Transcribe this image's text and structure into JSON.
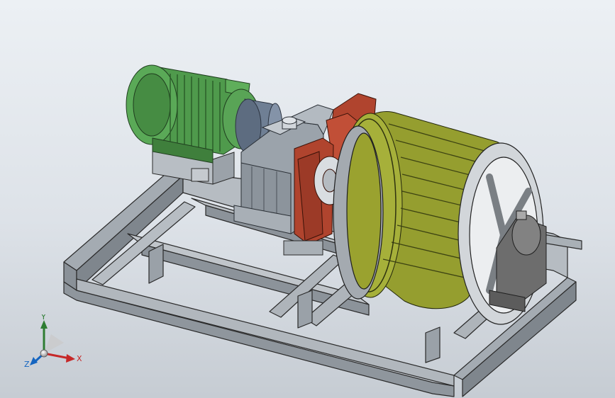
{
  "viewport": {
    "background_top": "#ecf0f4",
    "background_bottom": "#c6ccd3"
  },
  "model": {
    "components": [
      "steel-base-frame",
      "electric-motor",
      "coupling",
      "gear-reducer",
      "brake",
      "winch-drum",
      "bearing-block"
    ],
    "colors": {
      "frame": "#9aa1a8",
      "motor": "#4f9a4c",
      "coupling": "#6f7f94",
      "reducer": "#9ba3ab",
      "brake": "#b0442e",
      "drum": "#8f9a2e",
      "bearing": "#6d6d6d"
    }
  },
  "triad": {
    "x_label": "X",
    "y_label": "Y",
    "z_label": "Z",
    "x_color": "#c62828",
    "y_color": "#2e7d32",
    "z_color": "#1565c0"
  }
}
